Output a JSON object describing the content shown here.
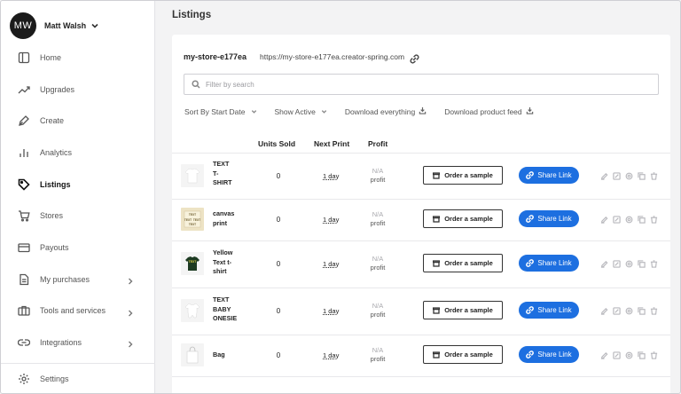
{
  "user": {
    "initials": "MW",
    "name": "Matt Walsh"
  },
  "sidebar": {
    "items": [
      {
        "label": "Home",
        "icon": "home-icon"
      },
      {
        "label": "Upgrades",
        "icon": "trending-up-icon"
      },
      {
        "label": "Create",
        "icon": "pen-icon"
      },
      {
        "label": "Analytics",
        "icon": "bar-chart-icon"
      },
      {
        "label": "Listings",
        "icon": "tag-icon",
        "active": true
      },
      {
        "label": "Stores",
        "icon": "cart-icon"
      },
      {
        "label": "Payouts",
        "icon": "card-icon"
      },
      {
        "label": "My purchases",
        "icon": "document-icon",
        "expandable": true
      },
      {
        "label": "Tools and services",
        "icon": "briefcase-icon",
        "expandable": true
      },
      {
        "label": "Integrations",
        "icon": "link-icon",
        "expandable": true
      }
    ],
    "settings": {
      "label": "Settings",
      "icon": "gear-icon"
    }
  },
  "page": {
    "title": "Listings"
  },
  "store": {
    "name": "my-store-e177ea",
    "url": "https://my-store-e177ea.creator-spring.com"
  },
  "search": {
    "placeholder": "Filter by search",
    "value": ""
  },
  "filters": {
    "sort": "Sort By Start Date",
    "show": "Show Active",
    "download_everything": "Download everything",
    "download_feed": "Download product feed"
  },
  "table": {
    "columns": {
      "units_sold": "Units Sold",
      "next_print": "Next Print",
      "profit": "Profit"
    },
    "rows": [
      {
        "name_lines": [
          "TEXT",
          "T-",
          "SHIRT"
        ],
        "units": "0",
        "next": "1 day",
        "profit_na": "N/A",
        "profit_label": "profit",
        "thumb": "white-tshirt",
        "thumb_text": ""
      },
      {
        "name_lines": [
          "canvas",
          "print"
        ],
        "units": "0",
        "next": "1 day",
        "profit_na": "N/A",
        "profit_label": "profit",
        "thumb": "canvas",
        "thumb_text": "TEXT"
      },
      {
        "name_lines": [
          "Yellow",
          "Text t-",
          "shirt"
        ],
        "units": "0",
        "next": "1 day",
        "profit_na": "N/A",
        "profit_label": "profit",
        "thumb": "green-tshirt",
        "thumb_text": "TEXT"
      },
      {
        "name_lines": [
          "TEXT",
          "BABY",
          "ONESIE"
        ],
        "units": "0",
        "next": "1 day",
        "profit_na": "N/A",
        "profit_label": "profit",
        "thumb": "onesie",
        "thumb_text": ""
      },
      {
        "name_lines": [
          "Bag"
        ],
        "units": "0",
        "next": "1 day",
        "profit_na": "N/A",
        "profit_label": "profit",
        "thumb": "bag",
        "thumb_text": ""
      }
    ],
    "order_label": "Order a sample",
    "share_label": "Share Link"
  },
  "colors": {
    "accent": "#1d6fe0",
    "avatar_bg": "#1b1b1b",
    "muted_icon": "#b8b8bd"
  }
}
